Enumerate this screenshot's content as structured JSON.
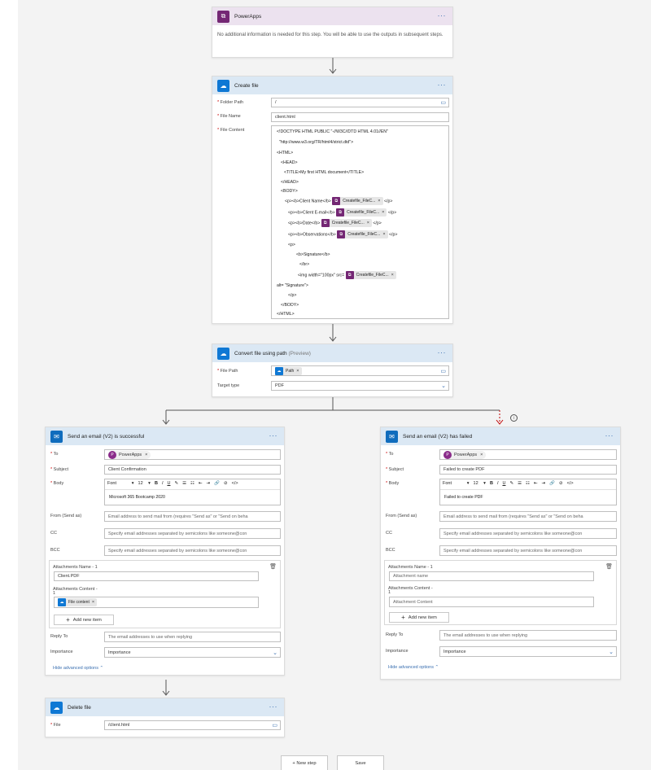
{
  "powerapps": {
    "title": "PowerApps",
    "message": "No additional information is needed for this step. You will be able to use the outputs in subsequent steps."
  },
  "create_file": {
    "title": "Create file",
    "folder_path_label": "Folder Path",
    "folder_path_value": "/",
    "file_name_label": "File Name",
    "file_name_value": "client.html",
    "file_content_label": "File Content",
    "content_lines": [
      "<!DOCTYPE HTML PUBLIC \"-//W3C//DTD HTML 4.01//EN\"",
      "\"http://www.w3.org/TR/html4/strict.dtd\">",
      "<HTML>",
      "<HEAD>",
      "<TITLE>My first HTML document</TITLE>",
      "</HEAD>",
      "<BODY>",
      "<p><b>Client Name</b>",
      "</p>",
      "<p><b>Client E-mail</b>",
      "</p>",
      "<p><b>Date</b>",
      "</p>",
      "<p><b>Observations</b>",
      "</p>",
      "<p>",
      "<b>Signature</b>",
      "</br>",
      "<img width=\"100px\" src=",
      "alt= \"Signature\">",
      "</p>",
      "</BODY>",
      "</HTML>"
    ],
    "token_label": "Createfile_FileC..."
  },
  "convert_file": {
    "title": "Convert file using path",
    "title_suffix": "(Preview)",
    "file_path_label": "File Path",
    "file_path_token": "Path",
    "target_type_label": "Target type",
    "target_type_value": "PDF"
  },
  "email_success": {
    "title": "Send an email (V2) is successful",
    "to_label": "To",
    "to_value": "PowerApps",
    "to_avatar": "P",
    "subject_label": "Subject",
    "subject_value": "Client Confirmation",
    "body_label": "Body",
    "body_value": "Microsoft 365 Bootcamp 2020",
    "from_label": "From (Send as)",
    "from_placeholder": "Email address to send mail from (requires \"Send as\" or \"Send on beha",
    "cc_label": "CC",
    "cc_placeholder": "Specify email addresses separated by semicolons like someone@con",
    "bcc_label": "BCC",
    "bcc_placeholder": "Specify email addresses separated by semicolons like someone@con",
    "attach_name_label": "Attachments Name - 1",
    "attach_name_value": "Client.PDF",
    "attach_content_label": "Attachments Content -",
    "attach_content_label2": "1",
    "attach_content_token": "File content",
    "add_item_label": "Add new item",
    "reply_to_label": "Reply To",
    "reply_to_placeholder": "The email addresses to use when replying",
    "importance_label": "Importance",
    "importance_value": "Importance",
    "hide_advanced": "Hide advanced options"
  },
  "email_failed": {
    "title": "Send an email (V2) has failed",
    "to_label": "To",
    "to_value": "PowerApps",
    "to_avatar": "P",
    "subject_label": "Subject",
    "subject_value": "Failed to create PDF",
    "body_label": "Body",
    "body_value": "Failed to create PDF",
    "from_label": "From (Send as)",
    "from_placeholder": "Email address to send mail from (requires \"Send as\" or \"Send on beha",
    "cc_label": "CC",
    "cc_placeholder": "Specify email addresses separated by semicolons like someone@con",
    "bcc_label": "BCC",
    "bcc_placeholder": "Specify email addresses separated by semicolons like someone@con",
    "attach_name_label": "Attachments Name - 1",
    "attach_name_placeholder": "Attachment name",
    "attach_content_label": "Attachments Content -",
    "attach_content_label2": "1",
    "attach_content_placeholder": "Attachment Content",
    "add_item_label": "Add new item",
    "reply_to_label": "Reply To",
    "reply_to_placeholder": "The email addresses to use when replying",
    "importance_label": "Importance",
    "importance_value": "Importance",
    "hide_advanced": "Hide advanced options"
  },
  "toolbar": {
    "font": "Font",
    "size": "12"
  },
  "delete_file": {
    "title": "Delete file",
    "file_label": "File",
    "file_value": "/client.html"
  },
  "footer": {
    "new_step": "+ New step",
    "save": "Save"
  },
  "colors": {
    "powerapps": "#742774",
    "onedrive": "#0f78d4",
    "outlook": "#0f6cbd",
    "link": "#3a6fb0",
    "failure_arrow": "#c00000"
  }
}
